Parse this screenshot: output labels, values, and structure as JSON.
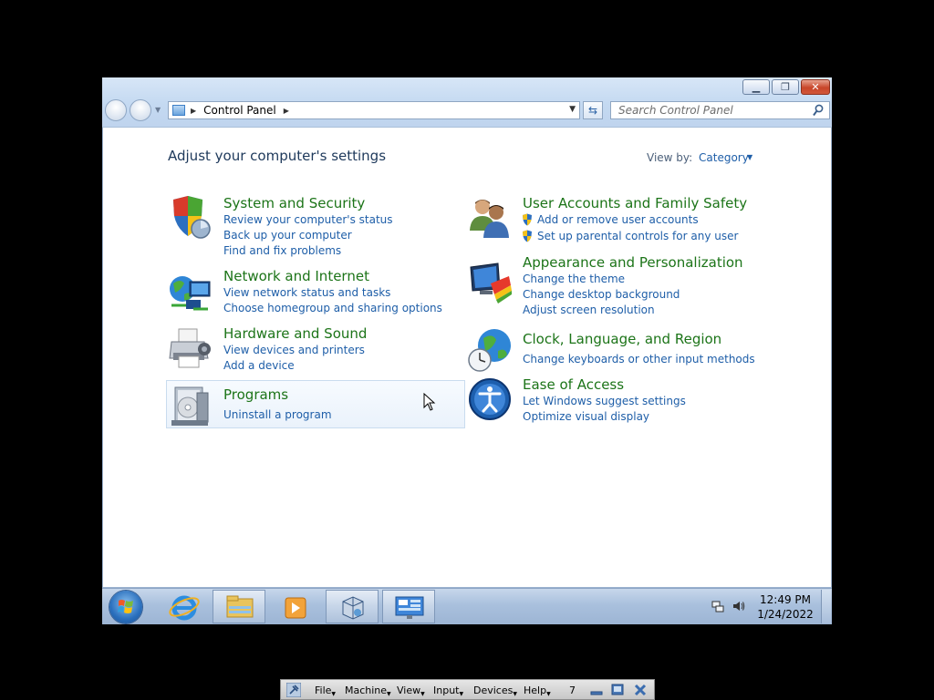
{
  "window": {
    "address": {
      "crumb": "Control Panel"
    },
    "search": {
      "placeholder": "Search Control Panel"
    }
  },
  "page": {
    "heading": "Adjust your computer's settings",
    "view_by_label": "View by:",
    "view_by_value": "Category"
  },
  "categories": {
    "system_security": {
      "title": "System and Security",
      "links": [
        "Review your computer's status",
        "Back up your computer",
        "Find and fix problems"
      ]
    },
    "network_internet": {
      "title": "Network and Internet",
      "links": [
        "View network status and tasks",
        "Choose homegroup and sharing options"
      ]
    },
    "hardware_sound": {
      "title": "Hardware and Sound",
      "links": [
        "View devices and printers",
        "Add a device"
      ]
    },
    "programs": {
      "title": "Programs",
      "links": [
        "Uninstall a program"
      ]
    },
    "user_accounts": {
      "title": "User Accounts and Family Safety",
      "links": [
        "Add or remove user accounts",
        "Set up parental controls for any user"
      ]
    },
    "appearance": {
      "title": "Appearance and Personalization",
      "links": [
        "Change the theme",
        "Change desktop background",
        "Adjust screen resolution"
      ]
    },
    "clock_region": {
      "title": "Clock, Language, and Region",
      "links": [
        "Change keyboards or other input methods"
      ]
    },
    "ease_access": {
      "title": "Ease of Access",
      "links": [
        "Let Windows suggest settings",
        "Optimize visual display"
      ]
    }
  },
  "taskbar": {
    "time": "12:49 PM",
    "date": "1/24/2022"
  },
  "vbox_menu": {
    "file": "File",
    "machine": "Machine",
    "view": "View",
    "input": "Input",
    "devices": "Devices",
    "help": "Help",
    "display_number": "7"
  },
  "colors": {
    "link": "#1e5ea8",
    "category_title": "#1c7418",
    "heading": "#1e395b"
  }
}
